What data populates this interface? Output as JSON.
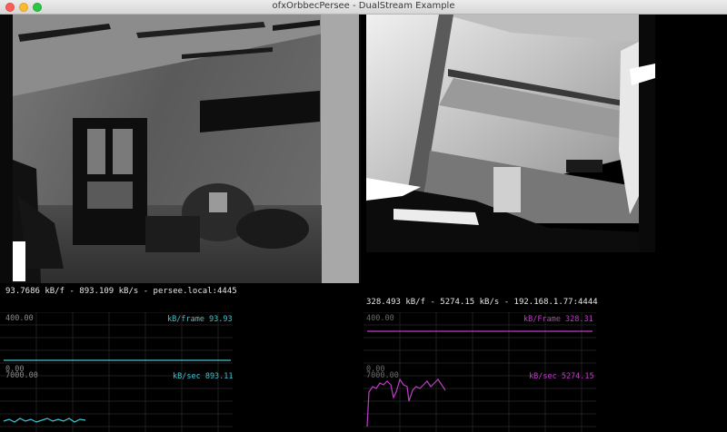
{
  "window": {
    "title": "ofxOrbbecPersee - DualStream Example"
  },
  "streams": [
    {
      "info_line": "93.7686 kB/f - 893.109 kB/s - persee.local:4445",
      "color": "#3fc5cf",
      "frame_plot": {
        "max_label": "400.00",
        "min_label": "0.00",
        "caption": "kB/frame 93.93"
      },
      "rate_plot": {
        "max_label": "7000.00",
        "caption": "kB/sec 893.11"
      }
    },
    {
      "info_line": "328.493 kB/f - 5274.15 kB/s - 192.168.1.77:4444",
      "color": "#c03cc9",
      "frame_plot": {
        "max_label": "400.00",
        "min_label": "0.00",
        "caption": "kB/Frame 328.31"
      },
      "rate_plot": {
        "max_label": "7000.00",
        "caption": "kB/sec 5274.15"
      }
    }
  ]
}
